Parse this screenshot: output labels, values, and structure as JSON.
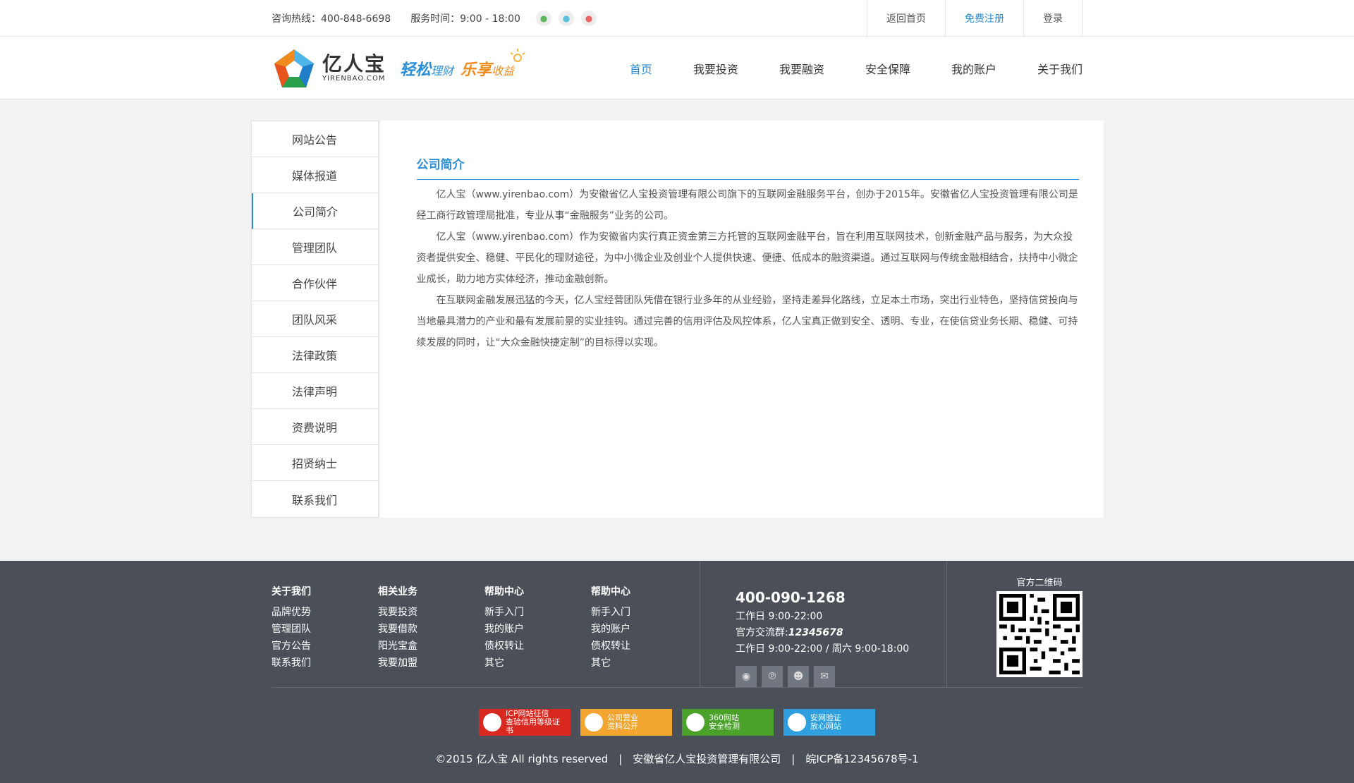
{
  "topbar": {
    "hotline": "咨询热线：400-848-6698",
    "service_time": "服务时间：9:00 - 18:00",
    "social": [
      "wechat-icon",
      "qq-icon",
      "weibo-icon"
    ],
    "links": [
      {
        "label": "返回首页",
        "active": false
      },
      {
        "label": "免费注册",
        "active": true
      },
      {
        "label": "登录",
        "active": false
      }
    ]
  },
  "header": {
    "logo_cn": "亿人宝",
    "logo_en": "YIRENBAO.COM",
    "slogan": {
      "p1": "轻松",
      "p2": "理财",
      "p3": "乐享",
      "p4": "收益"
    },
    "nav": [
      "首页",
      "我要投资",
      "我要融资",
      "安全保障",
      "我的账户",
      "关于我们"
    ],
    "nav_active": 0
  },
  "sidebar": {
    "items": [
      "网站公告",
      "媒体报道",
      "公司简介",
      "管理团队",
      "合作伙伴",
      "团队风采",
      "法律政策",
      "法律声明",
      "资费说明",
      "招贤纳士",
      "联系我们"
    ],
    "active": 2
  },
  "content": {
    "title": "公司简介",
    "paragraphs": [
      "亿人宝（www.yirenbao.com）为安徽省亿人宝投资管理有限公司旗下的互联网金融服务平台，创办于2015年。安徽省亿人宝投资管理有限公司是经工商行政管理局批准，专业从事“金融服务”业务的公司。",
      "亿人宝（www.yirenbao.com）作为安徽省内实行真正资金第三方托管的互联网金融平台，旨在利用互联网技术，创新金融产品与服务，为大众投资者提供安全、稳健、平民化的理财途径，为中小微企业及创业个人提供快速、便捷、低成本的融资渠道。通过互联网与传统金融相结合，扶持中小微企业成长，助力地方实体经济，推动金融创新。",
      "在互联网金融发展迅猛的今天，亿人宝经营团队凭借在银行业多年的从业经验，坚持走差异化路线，立足本土市场，突出行业特色，坚持信贷投向与当地最具潜力的产业和最有发展前景的实业挂钩。通过完善的信用评估及风控体系，亿人宝真正做到安全、透明、专业，在使信贷业务长期、稳健、可持续发展的同时，让“大众金融快捷定制”的目标得以实现。"
    ]
  },
  "footer": {
    "columns": [
      {
        "title": "关于我们",
        "links": [
          "品牌优势",
          "管理团队",
          "官方公告",
          "联系我们"
        ]
      },
      {
        "title": "相关业务",
        "links": [
          "我要投资",
          "我要借款",
          "阳光宝盒",
          "我要加盟"
        ]
      },
      {
        "title": "帮助中心",
        "links": [
          "新手入门",
          "我的账户",
          "债权转让",
          "其它"
        ]
      },
      {
        "title": "帮助中心",
        "links": [
          "新手入门",
          "我的账户",
          "债权转让",
          "其它"
        ]
      }
    ],
    "phone": "400-090-1268",
    "workday": "工作日 9:00-22:00",
    "group_label": "官方交流群:",
    "group_number": "12345678",
    "hours": "工作日 9:00-22:00 / 周六 9:00-18:00",
    "social": [
      "weibo-icon",
      "pinterest-icon",
      "user-group-icon",
      "mail-icon"
    ],
    "qr_label": "官方二维码",
    "badges": [
      {
        "line1": "ICP网站征信",
        "line2": "查验信用等级证书",
        "color": "#d9281f"
      },
      {
        "line1": "公司营业",
        "line2": "资料公开",
        "color": "#f2a630"
      },
      {
        "line1": "360网站",
        "line2": "安全检测",
        "color": "#4aa22a"
      },
      {
        "line1": "安网验证",
        "line2": "放心网站",
        "color": "#2f9fe0"
      }
    ],
    "copyright": "©2015 亿人宝 All rights reserved　|　安徽省亿人宝投资管理有限公司　|　皖ICP备12345678号-1"
  }
}
